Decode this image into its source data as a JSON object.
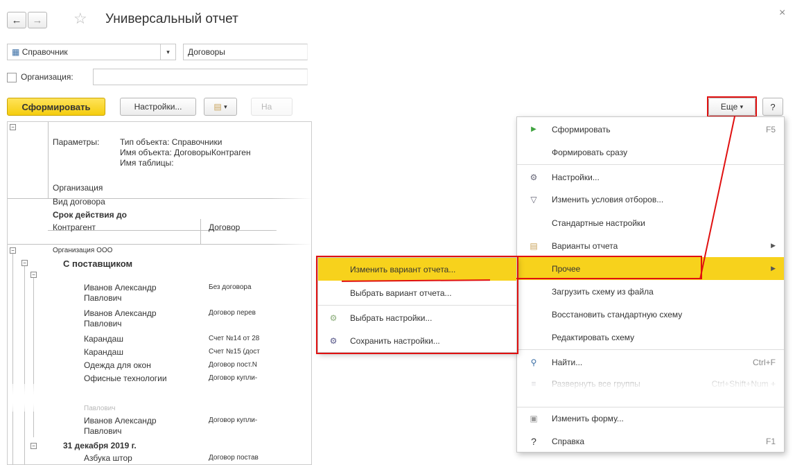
{
  "window": {
    "title": "Универсальный отчет",
    "close": "×"
  },
  "filters": {
    "kind_label": "Справочник",
    "kind_value": "Договоры",
    "org_label": "Организация:"
  },
  "toolbar": {
    "generate": "Сформировать",
    "settings": "Настройки...",
    "truncated": "На",
    "more": "Еще",
    "help": "?"
  },
  "report": {
    "params_label": "Параметры:",
    "params_lines": [
      "Тип объекта: Справочники",
      "Имя объекта: ДоговорыКонтраген",
      "Имя таблицы:"
    ],
    "header_rows": [
      "Организация",
      "Вид договора",
      "Срок действия до"
    ],
    "col_counterparty": "Контрагент",
    "col_contract": "Договор",
    "org_group": "Организация ООО",
    "supplier_group": "С поставщиком",
    "rows": [
      {
        "name": "Иванов Александр\nПавлович",
        "contract": "Без договора"
      },
      {
        "name": "Иванов Александр\nПавлович",
        "contract": "Договор перев"
      },
      {
        "name": "Карандаш",
        "contract": "Счет №14 от 28"
      },
      {
        "name": "Карандаш",
        "contract": "Счет №15 (дост"
      },
      {
        "name": "Одежда для окон",
        "contract": "Договор пост.N"
      },
      {
        "name": "Офисные технологии",
        "contract": "Договор купли-"
      },
      {
        "name": "Павлович",
        "contract": ""
      },
      {
        "name": "Иванов Александр\nПавлович",
        "contract": "Договор купли-"
      }
    ],
    "date_group": "31 декабря 2019 г.",
    "last_row": {
      "name": "Азбука штор",
      "contract": "Договор постав"
    }
  },
  "more_menu": {
    "items": [
      {
        "label": "Сформировать",
        "shortcut": "F5",
        "icon": "play-icon"
      },
      {
        "label": "Формировать сразу",
        "shortcut": "",
        "icon": ""
      },
      {
        "label": "Настройки...",
        "shortcut": "",
        "icon": "settings-icon"
      },
      {
        "label": "Изменить условия отборов...",
        "shortcut": "",
        "icon": "filter-icon"
      },
      {
        "label": "Стандартные настройки",
        "shortcut": "",
        "icon": ""
      },
      {
        "label": "Варианты отчета",
        "shortcut": "",
        "icon": "variants-icon"
      },
      {
        "label": "Прочее",
        "shortcut": "",
        "icon": ""
      },
      {
        "label": "Загрузить схему из файла",
        "shortcut": "",
        "icon": ""
      },
      {
        "label": "Восстановить стандартную схему",
        "shortcut": "",
        "icon": ""
      },
      {
        "label": "Редактировать схему",
        "shortcut": "",
        "icon": ""
      },
      {
        "label": "Найти...",
        "shortcut": "Ctrl+F",
        "icon": "search-icon"
      },
      {
        "label": "Развернуть все группы",
        "shortcut": "Ctrl+Shift+Num +",
        "icon": "expand-icon"
      },
      {
        "label": "Изменить форму...",
        "shortcut": "",
        "icon": "form-icon"
      },
      {
        "label": "Справка",
        "shortcut": "F1",
        "icon": "help-icon"
      }
    ]
  },
  "submenu": {
    "items": [
      {
        "label": "Изменить вариант отчета..."
      },
      {
        "label": "Выбрать вариант отчета..."
      },
      {
        "label": "Выбрать настройки..."
      },
      {
        "label": "Сохранить настройки..."
      }
    ]
  },
  "colors": {
    "accent": "#f7d21c",
    "highlight": "#e01010"
  }
}
